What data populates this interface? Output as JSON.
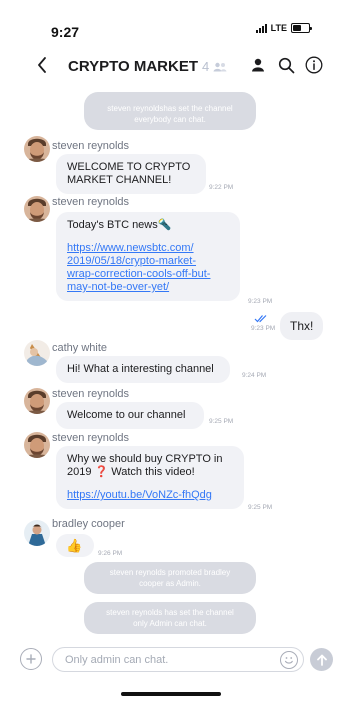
{
  "status_bar": {
    "time": "9:27",
    "network": "LTE"
  },
  "header": {
    "title": "CRYPTO MARKET",
    "member_count": "4"
  },
  "icons": {
    "back": "chevron-left-icon",
    "members": "person-icon",
    "search": "search-icon",
    "info": "info-icon",
    "add": "plus-icon",
    "emoji": "smiley-icon",
    "send": "arrow-up-icon",
    "read_receipt": "double-check-icon"
  },
  "colors": {
    "link": "#3478f6",
    "system_bubble": "#d9dbe2",
    "incoming_bubble": "#f1f2f6",
    "read_receipt": "#3478f6"
  },
  "chat": {
    "system_top": "steven reynoldshas set the channel everybody can chat.",
    "messages": [
      {
        "sender": "steven reynolds",
        "lines": [
          "WELCOME TO CRYPTO",
          "MARKET CHANNEL!"
        ],
        "time": "9:22 PM"
      },
      {
        "sender": "steven reynolds",
        "text": "Today's BTC news🔦",
        "link_lines": [
          "https://www.newsbtc.com/",
          "2019/05/18/crypto-market-",
          "wrap-correction-cools-off-but-",
          "may-not-be-over-yet/"
        ],
        "time": "9:23 PM"
      },
      {
        "sender": "cathy white",
        "text": "Hi! What a interesting channel",
        "time": "9:24 PM"
      },
      {
        "sender": "steven reynolds",
        "text": "Welcome to our channel",
        "time": "9:25 PM"
      },
      {
        "sender": "steven reynolds",
        "lines": [
          "Why we should buy CRYPTO in",
          "2019 ❓ Watch this video!"
        ],
        "link": "https://youtu.be/VoNZc-fhQdg",
        "time": "9:25 PM"
      },
      {
        "sender": "bradley cooper",
        "text": "👍",
        "time": "9:26 PM"
      }
    ],
    "outgoing": {
      "text": "Thx!",
      "time": "9:23 PM"
    },
    "system_promoted": "steven reynolds promoted bradley cooper as Admin.",
    "system_admin_only": "steven reynolds has set the channel only Admin can chat."
  },
  "composer": {
    "placeholder": "Only admin can chat."
  }
}
